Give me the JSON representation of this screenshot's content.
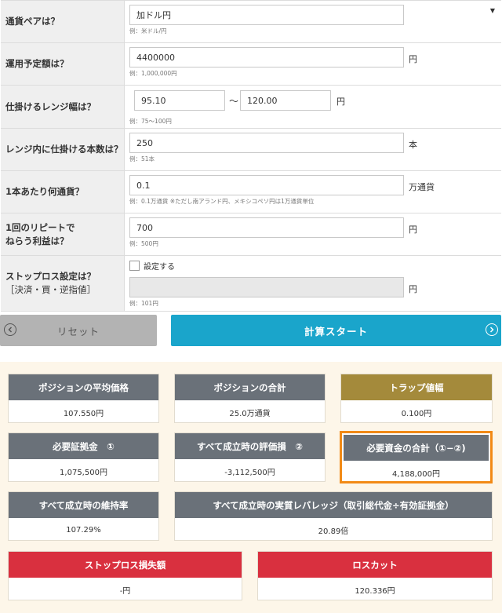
{
  "form": {
    "pair": {
      "label": "通貨ペアは？",
      "value": "加ドル円",
      "example": "例：米ドル/円"
    },
    "amount": {
      "label": "運用予定額は？",
      "value": "4400000",
      "unit": "円",
      "example": "例：1,000,000円"
    },
    "range": {
      "label": "仕掛けるレンジ幅は？",
      "low": "95.10",
      "sep": "〜",
      "high": "120.00",
      "unit": "円",
      "example": "例：75〜100円"
    },
    "count": {
      "label": "レンジ内に仕掛ける本数は？",
      "value": "250",
      "unit": "本",
      "example": "例：51本"
    },
    "lot": {
      "label": "1本あたり何通貨？",
      "value": "0.1",
      "unit": "万通貨",
      "example": "例：0.1万通貨 ※ただし南アランド円、メキシコペソ円は1万通貨単位"
    },
    "profit": {
      "label1": "1回のリピートで",
      "label2": "ねらう利益は？",
      "value": "700",
      "unit": "円",
      "example": "例：500円"
    },
    "stoploss": {
      "label1": "ストップロス設定は？",
      "label2": "［決済・買・逆指値］",
      "checkbox": "設定する",
      "value": "",
      "unit": "円",
      "example": "例：101円"
    }
  },
  "buttons": {
    "reset": "リセット",
    "start": "計算スタート"
  },
  "results": {
    "avg_price": {
      "title": "ポジションの平均価格",
      "value": "107.550円"
    },
    "total_pos": {
      "title": "ポジションの合計",
      "value": "25.0万通貨"
    },
    "trap": {
      "title": "トラップ値幅",
      "value": "0.100円"
    },
    "margin": {
      "title": "必要証拠金　①",
      "value": "1,075,500円"
    },
    "eval_loss": {
      "title": "すべて成立時の評価損　②",
      "value": "-3,112,500円"
    },
    "required": {
      "title": "必要資金の合計（①−②)",
      "value": "4,188,000円"
    },
    "maint": {
      "title": "すべて成立時の維持率",
      "value": "107.29%"
    },
    "leverage": {
      "title": "すべて成立時の実質レバレッジ（取引総代金÷有効証拠金）",
      "value": "20.89倍"
    },
    "sl_loss": {
      "title": "ストップロス損失額",
      "value": "-円"
    },
    "losscut": {
      "title": "ロスカット",
      "value": "120.336円"
    }
  },
  "colors": {
    "accent": "#1aa5cb",
    "header": "#6a7179",
    "gold": "#a48a3b",
    "red": "#d9303f",
    "highlight": "#f28a16"
  }
}
